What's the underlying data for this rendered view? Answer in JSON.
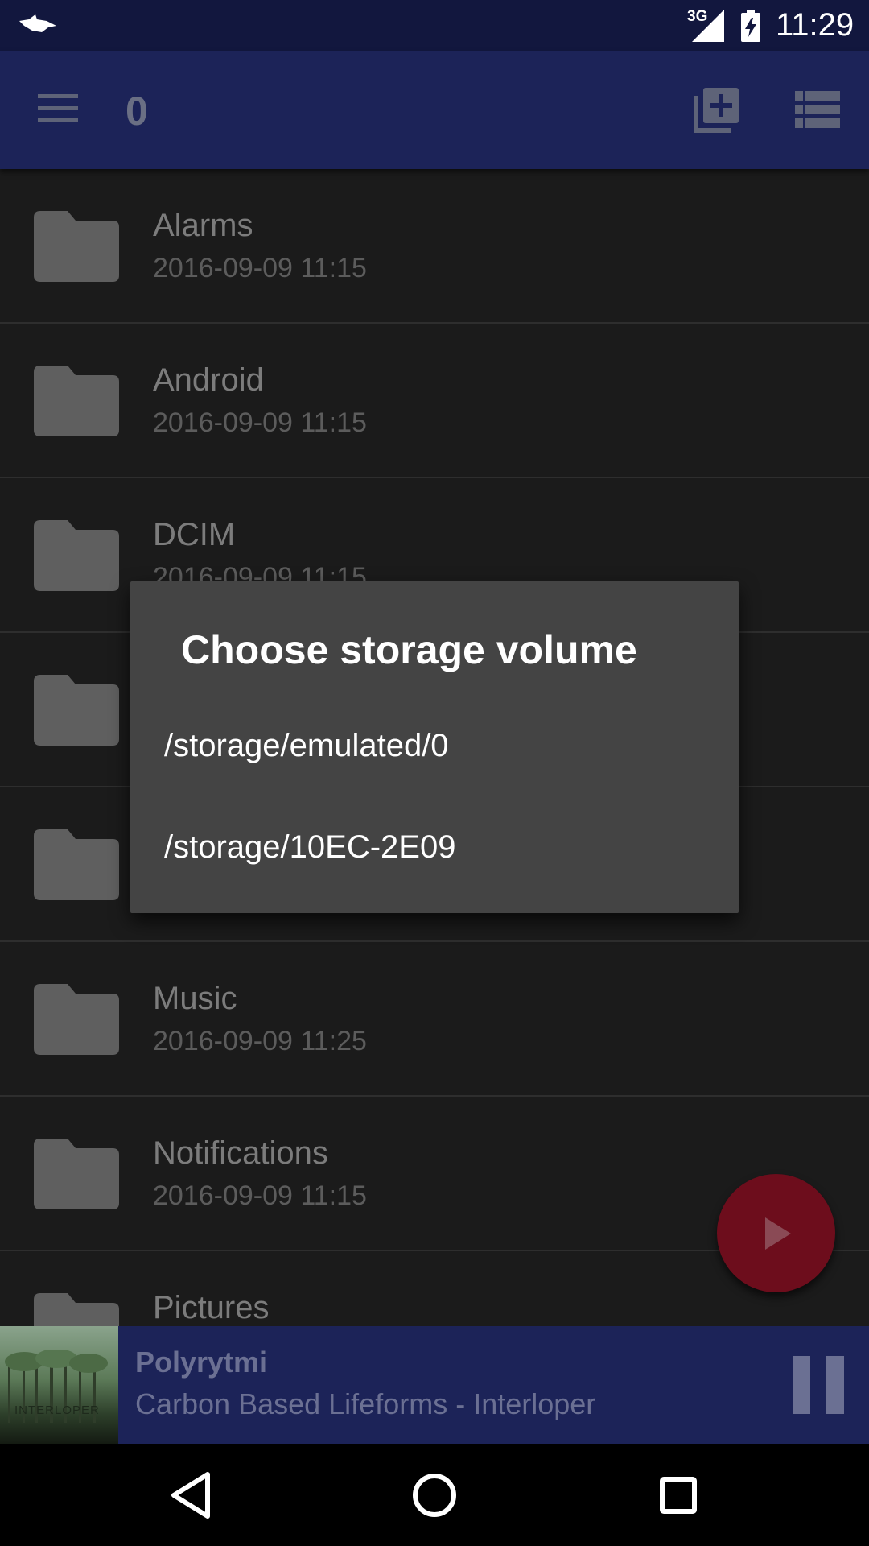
{
  "status_bar": {
    "network_label": "3G",
    "time": "11:29"
  },
  "app_bar": {
    "title": "0",
    "icons": [
      "menu-icon",
      "add-to-queue-icon",
      "list-view-icon"
    ]
  },
  "files": [
    {
      "name": "Alarms",
      "date": "2016-09-09 11:15"
    },
    {
      "name": "Android",
      "date": "2016-09-09 11:15"
    },
    {
      "name": "DCIM",
      "date": "2016-09-09 11:15"
    },
    {
      "name": "",
      "date": ""
    },
    {
      "name": "",
      "date": ""
    },
    {
      "name": "Music",
      "date": "2016-09-09 11:25"
    },
    {
      "name": "Notifications",
      "date": "2016-09-09 11:15"
    },
    {
      "name": "Pictures",
      "date": ""
    }
  ],
  "dialog": {
    "title": "Choose storage volume",
    "options": [
      "/storage/emulated/0",
      "/storage/10EC-2E09"
    ]
  },
  "now_playing": {
    "track": "Polyrytmi",
    "artist": "Carbon Based Lifeforms - Interloper",
    "album_art_text": "INTERLOPER"
  },
  "colors": {
    "app_bar": "#1c2358",
    "status_bar": "#12173e",
    "list_bg": "#1b1b1b",
    "dialog_bg": "#444444",
    "fab": "#6d0d1c"
  }
}
